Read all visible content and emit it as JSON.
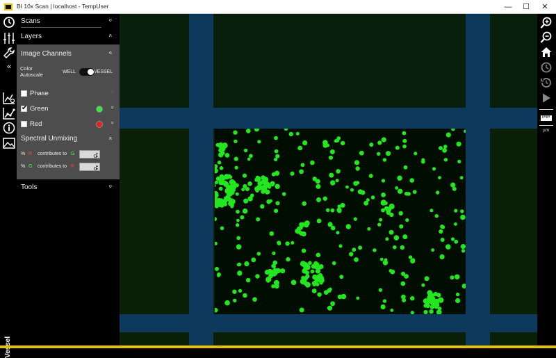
{
  "window": {
    "title": "BI 10x Scan | localhost - TempUser",
    "minimize_glyph": "—",
    "maximize_glyph": "☐",
    "close_glyph": "✕"
  },
  "left_rail": {
    "icons": [
      "clock-icon",
      "sliders-icon",
      "wrench-icon",
      "collapse-left-icon",
      "graph-settings-icon",
      "scatter-graph-icon",
      "info-icon",
      "image-icon"
    ],
    "collapse_glyph": "«",
    "vertical_label": "Vessel"
  },
  "sidebar": {
    "scans_label": "Scans",
    "layers_label": "Layers",
    "tools_label": "Tools",
    "chev_down": "»",
    "chev_up": "«"
  },
  "image_channels": {
    "title": "Image Channels",
    "autoscale_label": "Color Autoscale",
    "toggle_left": "WELL",
    "toggle_right": "VESSEL",
    "toggle_value": "VESSEL",
    "channels": [
      {
        "name": "Phase",
        "checked": false,
        "color": ""
      },
      {
        "name": "Green",
        "checked": true,
        "color": "#3ce63c"
      },
      {
        "name": "Red",
        "checked": false,
        "color": "#e82020"
      }
    ],
    "check_glyph": "✔"
  },
  "spectral_unmixing": {
    "title": "Spectral Unmixing",
    "rows": [
      {
        "pct": "%",
        "from": "R",
        "text": "contributes to",
        "to": "G",
        "value": "0"
      },
      {
        "pct": "%",
        "from": "G",
        "text": "contributes to",
        "to": "R",
        "value": "0"
      }
    ],
    "spin_up": "▲",
    "spin_down": "▼"
  },
  "right_rail": {
    "icons": [
      "zoom-in-icon",
      "zoom-out-icon",
      "home-icon",
      "refresh-icon",
      "history-icon",
      "play-icon",
      "ruler-icon"
    ],
    "scale_unit": "µm"
  },
  "colors": {
    "accent": "#e8c000",
    "cell_green": "#22e61e",
    "grid_blue": "#0d3a5c",
    "panel_bg": "#4d4d4d"
  }
}
